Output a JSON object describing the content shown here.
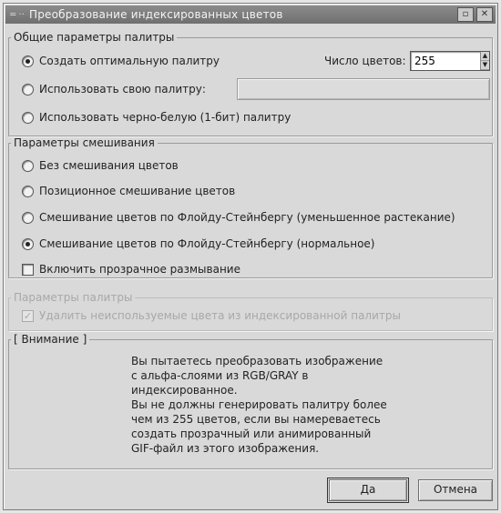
{
  "window": {
    "title": "Преобразование индексированных цветов"
  },
  "palette": {
    "legend": "Общие параметры палитры",
    "optimal_label": "Создать оптимальную палитру",
    "color_count_label": "Число цветов:",
    "color_count_value": "255",
    "custom_label": "Использовать свою палитру:",
    "bw_label": "Использовать черно-белую (1-бит) палитру"
  },
  "dither": {
    "legend": "Параметры смешивания",
    "none_label": "Без смешивания цветов",
    "positional_label": "Позиционное смешивание цветов",
    "fs_reduced_label": "Смешивание цветов по Флойду-Стейнбергу (уменьшенное растекание)",
    "fs_normal_label": "Смешивание цветов по Флойду-Стейнбергу (нормальное)",
    "transparency_label": "Включить прозрачное размывание"
  },
  "palette_opts": {
    "legend": "Параметры палитры",
    "remove_unused_label": "Удалить неиспользуемые цвета из индексированной палитры"
  },
  "warning": {
    "legend": "[ Внимание ]",
    "text": "Вы пытаетесь преобразовать изображение\nс альфа-слоями из RGB/GRAY в\nиндексированное.\nВы не должны генерировать палитру более\nчем из 255 цветов, если вы намереваетесь\nсоздать прозрачный или анимированный\nGIF-файл из этого изображения."
  },
  "buttons": {
    "ok": "Да",
    "cancel": "Отмена"
  }
}
